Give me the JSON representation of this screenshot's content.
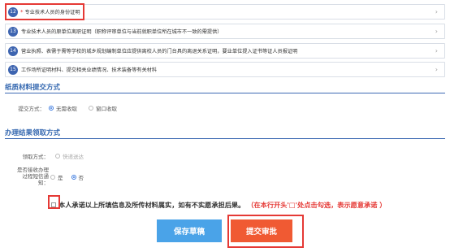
{
  "materials": [
    {
      "num": "12",
      "required": true,
      "text": "专业技术人员的身份证明"
    },
    {
      "num": "13",
      "required": false,
      "text": "专业技术人员的原单位离职证明（职称评审单位与当前就职单位所在城市不一致的需提供）"
    },
    {
      "num": "14",
      "required": false,
      "text": "营业执照、表需于需等学校的城乡规划编制单位应提供离校人员的门台具的离退关系证明，要业单位提入证书等证人员报证明"
    },
    {
      "num": "15",
      "required": false,
      "text": "工作场所证明材料、提交相关业绩情况、技术装备等有关材料"
    }
  ],
  "required_mark": "*",
  "chevron": "›",
  "paper": {
    "title": "纸质材料提交方式",
    "label": "提交方式：",
    "options": [
      {
        "label": "无需收取",
        "checked": true,
        "dim": false
      },
      {
        "label": "窗口收取",
        "checked": false,
        "dim": false
      }
    ]
  },
  "result": {
    "title": "办理结果领取方式",
    "pickup_label": "领取方式：",
    "pickup_option": "快递送达",
    "sms_label_line1": "是否接收办理",
    "sms_label_line2": "过程短信通",
    "sms_label_line3": "知：",
    "sms_options": [
      {
        "label": "是",
        "checked": false
      },
      {
        "label": "否",
        "checked": true
      }
    ]
  },
  "commitment": {
    "text": "本人承诺以上所填信息及所传材料属实，如有不实愿承担后果。",
    "hint": "（在本行开头'□'处点击勾选，表示愿意承诺 ）"
  },
  "buttons": {
    "save": "保存草稿",
    "submit": "提交审批"
  },
  "colors": {
    "accent_blue": "#3568b0",
    "save_button": "#4aa3e8",
    "submit_button": "#f05a33",
    "highlight_red": "#e53935"
  }
}
